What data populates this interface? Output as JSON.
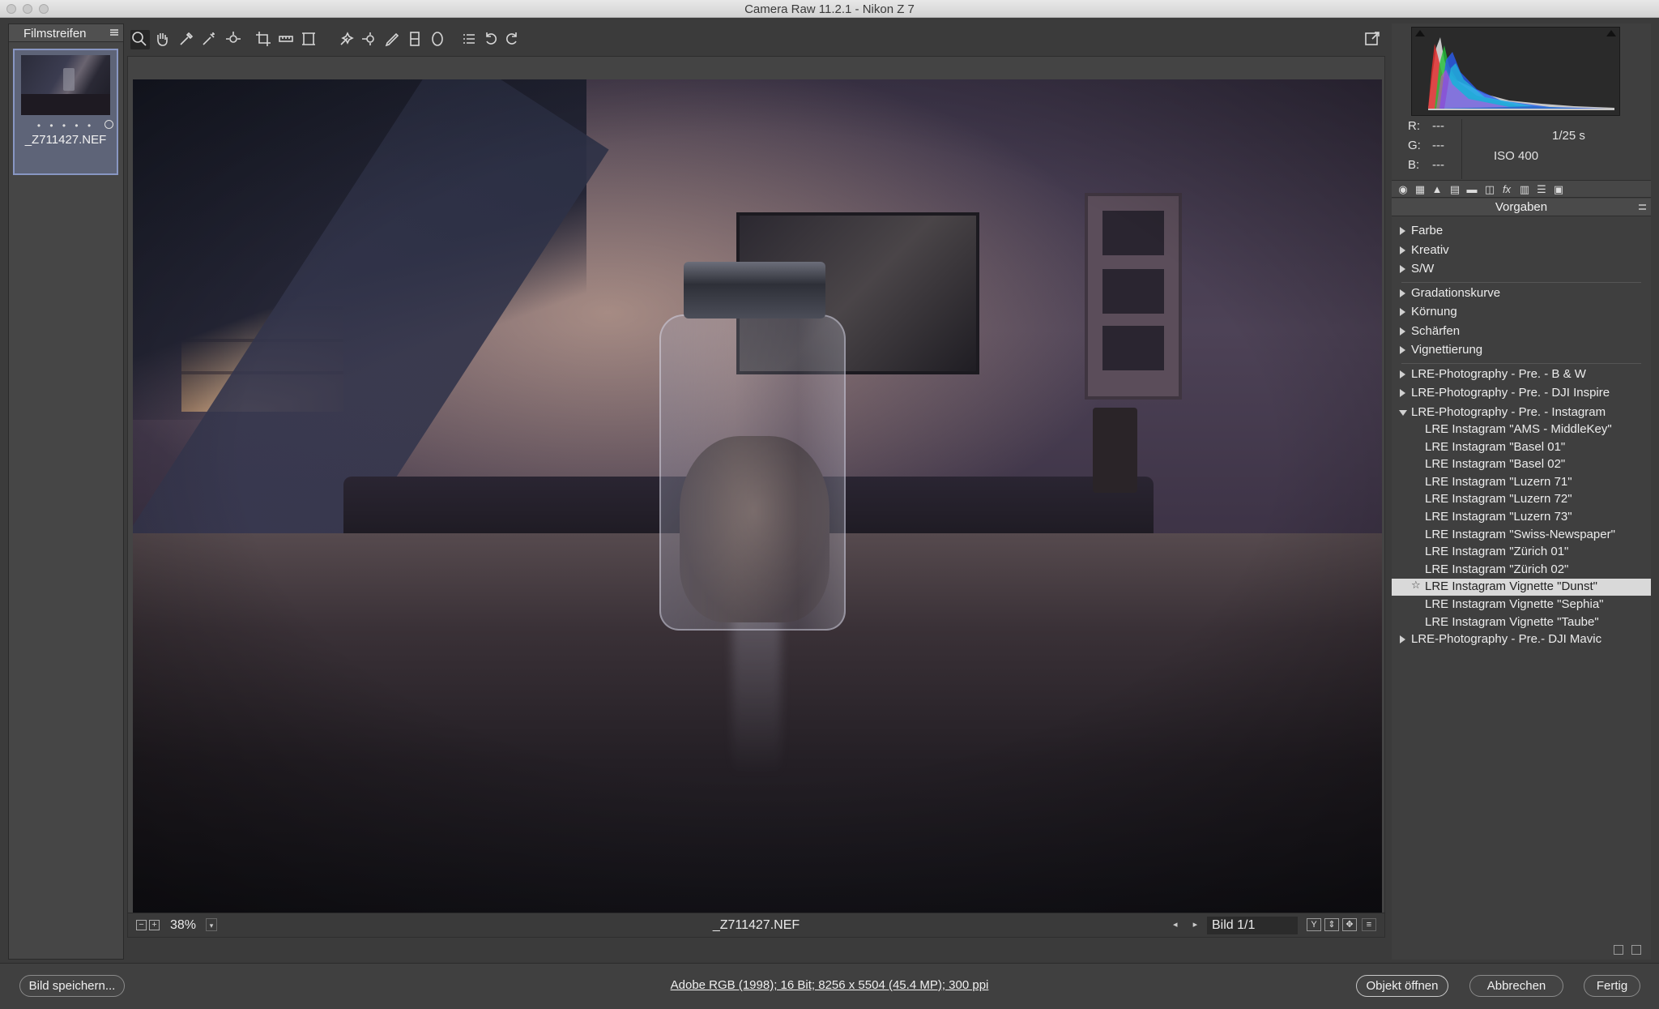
{
  "window": {
    "title": "Camera Raw 11.2.1 - Nikon Z 7"
  },
  "filmstrip": {
    "header": "Filmstreifen",
    "items": [
      {
        "name": "_Z711427.NEF",
        "rating_dots": "• • • • •"
      }
    ]
  },
  "toolbar": {
    "tools": [
      "zoom-tool",
      "hand-tool",
      "white-balance-tool",
      "color-sampler-tool",
      "targeted-adjustment-tool",
      "crop-tool",
      "straighten-tool",
      "transform-tool",
      "spot-removal-tool",
      "red-eye-tool",
      "adjustment-brush",
      "graduated-filter",
      "radial-filter",
      "preferences",
      "rotate-left",
      "rotate-right"
    ],
    "fullscreen_icon": "fullscreen-toggle-icon"
  },
  "canvas": {
    "zoom": "38%",
    "filename": "_Z711427.NEF",
    "image_counter": "Bild 1/1",
    "view_buttons": [
      "Y",
      "⇕",
      "✥"
    ]
  },
  "histogram": {
    "r_label": "R:",
    "r_value": "---",
    "g_label": "G:",
    "g_value": "---",
    "b_label": "B:",
    "b_value": "---",
    "shutter": "1/25 s",
    "iso": "ISO 400"
  },
  "panel": {
    "title": "Vorgaben",
    "tabs": [
      "basic-icon",
      "tone-curve-icon",
      "detail-icon",
      "hsl-icon",
      "split-toning-icon",
      "lens-icon",
      "fx-icon",
      "calibration-icon",
      "presets-icon",
      "snapshots-icon"
    ]
  },
  "presets": {
    "groups_a": [
      "Farbe",
      "Kreativ",
      "S/W"
    ],
    "groups_b": [
      "Gradationskurve",
      "Körnung",
      "Schärfen",
      "Vignettierung"
    ],
    "groups_c": [
      "LRE-Photography - Pre. - B & W",
      "LRE-Photography - Pre. - DJI Inspire",
      "LRE-Photography - Pre. - Instagram"
    ],
    "instagram_children": [
      "LRE Instagram \"AMS - MiddleKey\"",
      "LRE Instagram \"Basel 01\"",
      "LRE Instagram \"Basel 02\"",
      "LRE Instagram \"Luzern 71\"",
      "LRE Instagram \"Luzern 72\"",
      "LRE Instagram \"Luzern 73\"",
      "LRE Instagram \"Swiss-Newspaper\"",
      "LRE Instagram \"Zürich 01\"",
      "LRE Instagram \"Zürich 02\"",
      "LRE Instagram Vignette \"Dunst\"",
      "LRE Instagram Vignette \"Sephia\"",
      "LRE Instagram Vignette \"Taube\""
    ],
    "selected_index": 9,
    "groups_d": [
      "LRE-Photography - Pre.- DJI Mavic"
    ]
  },
  "bottom": {
    "save": "Bild speichern...",
    "workflow": "Adobe RGB (1998); 16 Bit; 8256 x 5504 (45.4 MP); 300 ppi",
    "open": "Objekt öffnen",
    "cancel": "Abbrechen",
    "done": "Fertig"
  },
  "colors": {
    "selection": "#d9d9d9",
    "panel_bg": "#3f3f3f",
    "filmstrip_selected": "#5e6478"
  }
}
